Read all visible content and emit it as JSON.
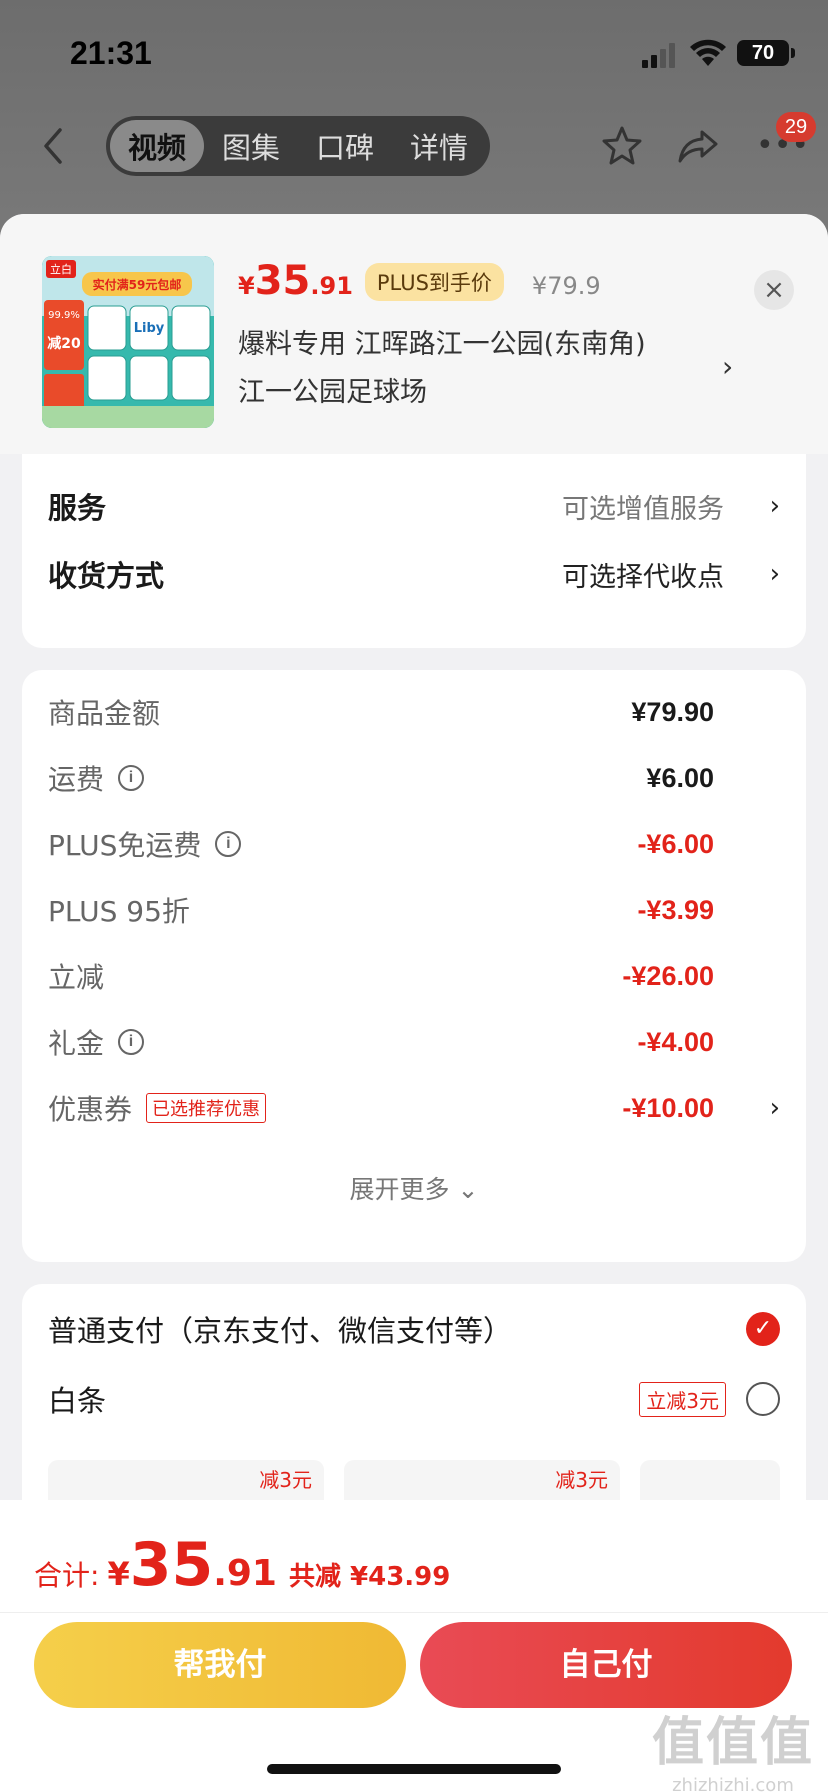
{
  "status": {
    "time": "21:31",
    "battery": "70"
  },
  "nav": {
    "tabs": [
      "视频",
      "图集",
      "口碑",
      "详情"
    ],
    "active_tab": 0,
    "badge": "29"
  },
  "product": {
    "thumb_brand": "立白",
    "thumb_banner": "实付满59元包邮",
    "thumb_badge_line1": "99.9%",
    "thumb_badge_line2": "减20",
    "thumb_logo": "Liby",
    "price_symbol": "¥",
    "price_int": "35",
    "price_dec": ".91",
    "plus_tag": "PLUS到手价",
    "orig_price": "¥79.9",
    "address_line1": "爆料专用  江晖路江一公园(东南角)",
    "address_line2": "江一公园足球场",
    "chevron": "›",
    "close": "×"
  },
  "options": {
    "service": {
      "label": "服务",
      "value": "可选增值服务"
    },
    "delivery": {
      "label": "收货方式",
      "value": "可选择代收点"
    },
    "chevron": "›"
  },
  "summary": {
    "rows": [
      {
        "label": "商品金额",
        "value": "¥79.90"
      },
      {
        "label": "运费",
        "value": "¥6.00"
      },
      {
        "label": "PLUS免运费",
        "value": "-¥6.00"
      },
      {
        "label": "PLUS 95折",
        "value": "-¥3.99"
      },
      {
        "label": "立减",
        "value": "-¥26.00"
      },
      {
        "label": "礼金",
        "value": "-¥4.00"
      },
      {
        "label": "优惠券",
        "value": "-¥10.00"
      }
    ],
    "info_glyph": "i",
    "coupon_tag": "已选推荐优惠",
    "expand": "展开更多 ⌄"
  },
  "payment": {
    "normal": "普通支付（京东支付、微信支付等）",
    "baitiao": "白条",
    "baitiao_tag": "立减3元",
    "plan_discount": "减3元",
    "check": "✓"
  },
  "bottom": {
    "total_label": "合计:",
    "total_symbol": "¥",
    "total_int": "35",
    "total_dec": ".91",
    "discount": "共减 ¥43.99",
    "help_pay": "帮我付",
    "self_pay": "自己付"
  },
  "watermark": {
    "logo": "值值值",
    "url": "zhizhizhi.com"
  }
}
